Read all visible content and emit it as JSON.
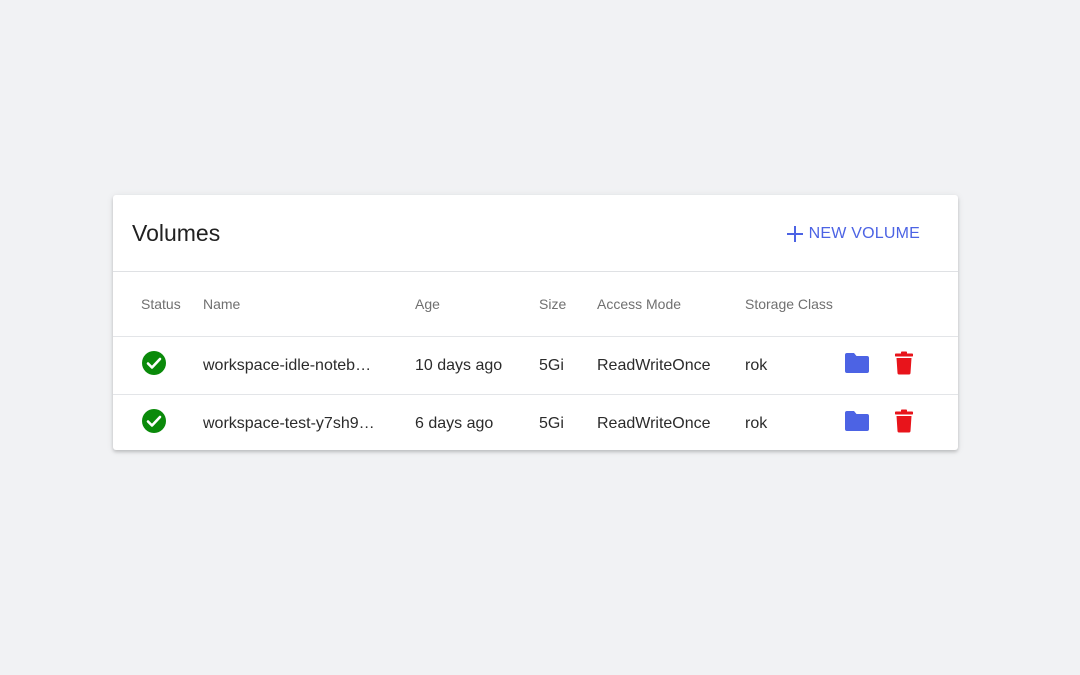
{
  "card": {
    "title": "Volumes",
    "new_button_label": "NEW VOLUME"
  },
  "columns": {
    "status": "Status",
    "name": "Name",
    "age": "Age",
    "size": "Size",
    "access_mode": "Access Mode",
    "storage_class": "Storage Class"
  },
  "rows": [
    {
      "status_icon": "check-circle-icon",
      "name": "workspace-idle-noteb…",
      "age": "10 days ago",
      "size": "5Gi",
      "access_mode": "ReadWriteOnce",
      "storage_class": "rok"
    },
    {
      "status_icon": "check-circle-icon",
      "name": "workspace-test-y7sh9…",
      "age": "6 days ago",
      "size": "5Gi",
      "access_mode": "ReadWriteOnce",
      "storage_class": "rok"
    }
  ],
  "colors": {
    "accent": "#4c63e4",
    "status_ok": "#0a8a0a",
    "danger": "#e8141b",
    "folder": "#4c63e4"
  }
}
